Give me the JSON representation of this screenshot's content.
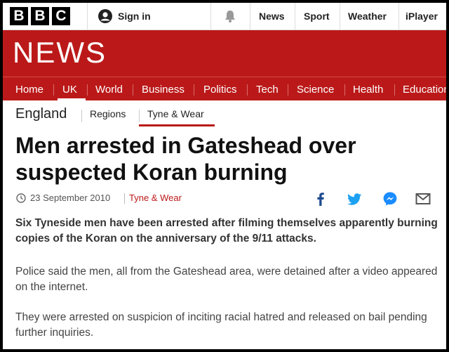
{
  "brand": {
    "letters": [
      "B",
      "B",
      "C"
    ]
  },
  "topbar": {
    "signin_label": "Sign in",
    "links": [
      "News",
      "Sport",
      "Weather",
      "iPlayer"
    ]
  },
  "banner": {
    "title": "NEWS",
    "color": "#bb1919"
  },
  "nav": {
    "items": [
      "Home",
      "UK",
      "World",
      "Business",
      "Politics",
      "Tech",
      "Science",
      "Health",
      "Education"
    ],
    "active": "UK"
  },
  "subnav": {
    "section": "England",
    "items": [
      "Regions",
      "Tyne & Wear"
    ],
    "active": "Tyne & Wear"
  },
  "article": {
    "headline_line1": "Men arrested in Gateshead over",
    "headline_line2": "suspected Koran burning",
    "date": "23 September 2010",
    "region": "Tyne & Wear",
    "share_icons": [
      "facebook-icon",
      "twitter-icon",
      "messenger-icon",
      "email-icon"
    ],
    "lead": "Six Tyneside men have been arrested after filming themselves apparently burning copies of the Koran on the anniversary of the 9/11 attacks.",
    "paragraphs": [
      "Police said the men, all from the Gateshead area, were detained after a video appeared on the internet.",
      "They were arrested on suspicion of inciting racial hatred and released on bail pending further inquiries."
    ]
  }
}
